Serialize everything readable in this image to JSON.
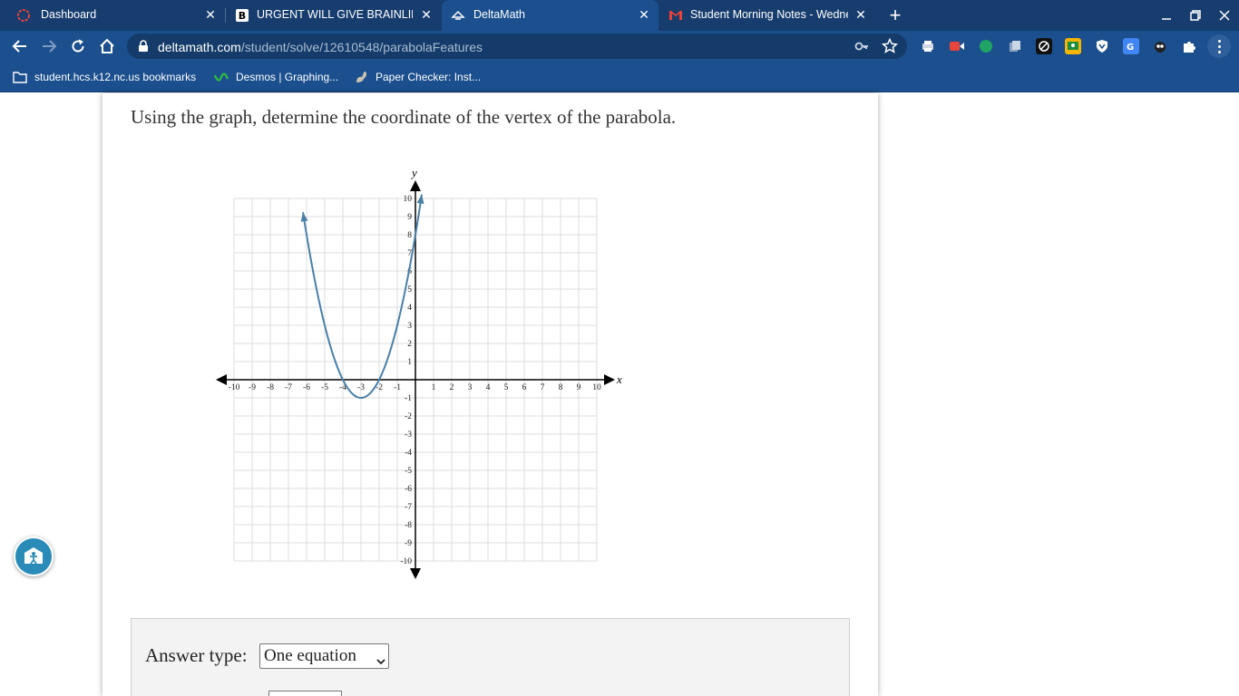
{
  "browser": {
    "tabs": [
      {
        "title": "Dashboard",
        "icon": "ring-icon",
        "active": false
      },
      {
        "title": "URGENT WILL GIVE BRAINLIEST",
        "icon": "brainly-icon",
        "active": false
      },
      {
        "title": "DeltaMath",
        "icon": "deltamath-icon",
        "active": true
      },
      {
        "title": "Student Morning Notes - Wednes",
        "icon": "gmail-icon",
        "active": false
      }
    ],
    "url_domain": "deltamath.com",
    "url_path": "/student/solve/12610548/parabolaFeatures",
    "bookmarks": [
      {
        "label": "student.hcs.k12.nc.us bookmarks",
        "icon": "folder-icon"
      },
      {
        "label": "Desmos | Graphing...",
        "icon": "desmos-icon"
      },
      {
        "label": "Paper Checker: Inst...",
        "icon": "squirrel-icon"
      }
    ],
    "colors": {
      "tabstrip": "#173d6e",
      "toolbar": "#1b4f8e"
    }
  },
  "question": {
    "text": "Using the graph, determine the coordinate of the vertex of the parabola."
  },
  "graph": {
    "x_axis_label": "x",
    "y_axis_label": "y",
    "x_range": [
      -10,
      10
    ],
    "y_range": [
      -10,
      10
    ],
    "x_ticks": [
      "-10",
      "-9",
      "-8",
      "-7",
      "-6",
      "-5",
      "-4",
      "-3",
      "-2",
      "-1",
      "1",
      "2",
      "3",
      "4",
      "5",
      "6",
      "7",
      "8",
      "9",
      "10"
    ],
    "y_ticks": [
      "10",
      "9",
      "8",
      "7",
      "6",
      "5",
      "4",
      "3",
      "2",
      "1",
      "-1",
      "-2",
      "-3",
      "-4",
      "-5",
      "-6",
      "-7",
      "-8",
      "-9",
      "-10"
    ],
    "parabola": {
      "a": 1,
      "h": -3,
      "k": -1,
      "x_from": -6.2,
      "x_to": 0.35
    },
    "curve_color": "#4a7fa8"
  },
  "answer": {
    "label": "Answer type:",
    "selected": "One equation"
  }
}
